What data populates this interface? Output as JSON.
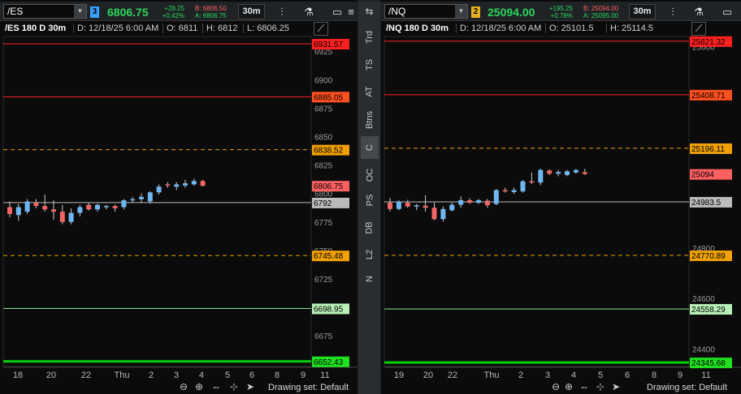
{
  "panels": [
    {
      "symbol": "/ES",
      "link_num": "3",
      "link_color": "#3aa0ff",
      "last": "6806.75",
      "change": "+28.25",
      "change_pct": "+0.42%",
      "bid": "B: 6806.50",
      "ask": "A: 6806.75",
      "timeframe": "30m",
      "info": {
        "title": "/ES 180 D 30m",
        "date": "D: 12/18/25 6:00 AM",
        "open": "O: 6811",
        "high": "H: 6812",
        "low": "L: 6806.25"
      },
      "y_range": [
        6648,
        6938
      ],
      "y_ticks": [
        "6925",
        "6900",
        "6875",
        "6850",
        "6825",
        "6800",
        "6775",
        "6750",
        "6725",
        "6700",
        "6675"
      ],
      "y_tick_values": [
        6925,
        6900,
        6875,
        6850,
        6825,
        6800,
        6775,
        6750,
        6725,
        6700,
        6675
      ],
      "x_ticks": [
        "18",
        "20",
        "22",
        "Thu",
        "2",
        "3",
        "4",
        "5",
        "6",
        "8",
        "9",
        "11"
      ],
      "levels": [
        {
          "value": 6931.57,
          "label": "6931.57",
          "color": "#ff2020",
          "bg": "#ff2020",
          "fg": "#000",
          "dash": false,
          "width": 1
        },
        {
          "value": 6885.05,
          "label": "6885.05",
          "color": "#ff2020",
          "bg": "#ff5020",
          "fg": "#000",
          "dash": false,
          "width": 1
        },
        {
          "value": 6838.52,
          "label": "6838.52",
          "color": "#f0a000",
          "bg": "#f0a000",
          "fg": "#000",
          "dash": true,
          "width": 1
        },
        {
          "value": 6792,
          "label": "6792",
          "color": "#bbbbbb",
          "bg": "#bbbbbb",
          "fg": "#000",
          "dash": false,
          "width": 1
        },
        {
          "value": 6745.48,
          "label": "6745.48",
          "color": "#f0a000",
          "bg": "#f0a000",
          "fg": "#000",
          "dash": true,
          "width": 1
        },
        {
          "value": 6698.95,
          "label": "6698.95",
          "color": "#88e888",
          "bg": "#b8f0b8",
          "fg": "#000",
          "dash": false,
          "width": 1
        },
        {
          "value": 6652.43,
          "label": "6652.43",
          "color": "#00d000",
          "bg": "#20e020",
          "fg": "#000",
          "dash": false,
          "width": 3
        }
      ],
      "last_label": {
        "value": 6806.75,
        "label": "6806.75",
        "bg": "#ff6060",
        "fg": "#000"
      },
      "candles": [
        {
          "o": 6788,
          "h": 6793,
          "l": 6779,
          "c": 6782
        },
        {
          "o": 6781,
          "h": 6791,
          "l": 6776,
          "c": 6788
        },
        {
          "o": 6784,
          "h": 6795,
          "l": 6782,
          "c": 6793
        },
        {
          "o": 6792,
          "h": 6795,
          "l": 6787,
          "c": 6789
        },
        {
          "o": 6789,
          "h": 6799,
          "l": 6784,
          "c": 6786
        },
        {
          "o": 6786,
          "h": 6794,
          "l": 6777,
          "c": 6784
        },
        {
          "o": 6784,
          "h": 6790,
          "l": 6773,
          "c": 6775
        },
        {
          "o": 6775,
          "h": 6787,
          "l": 6773,
          "c": 6783
        },
        {
          "o": 6783,
          "h": 6790,
          "l": 6780,
          "c": 6788
        },
        {
          "o": 6790,
          "h": 6792,
          "l": 6785,
          "c": 6786
        },
        {
          "o": 6786,
          "h": 6791,
          "l": 6784,
          "c": 6790
        },
        {
          "o": 6788,
          "h": 6790,
          "l": 6786,
          "c": 6789
        },
        {
          "o": 6789,
          "h": 6790,
          "l": 6784,
          "c": 6787
        },
        {
          "o": 6788,
          "h": 6795,
          "l": 6786,
          "c": 6794
        },
        {
          "o": 6794,
          "h": 6797,
          "l": 6792,
          "c": 6795
        },
        {
          "o": 6795,
          "h": 6800,
          "l": 6792,
          "c": 6797
        },
        {
          "o": 6793,
          "h": 6802,
          "l": 6791,
          "c": 6801
        },
        {
          "o": 6801,
          "h": 6808,
          "l": 6799,
          "c": 6806
        },
        {
          "o": 6808,
          "h": 6810,
          "l": 6805,
          "c": 6807
        },
        {
          "o": 6806,
          "h": 6810,
          "l": 6803,
          "c": 6808
        },
        {
          "o": 6807,
          "h": 6812,
          "l": 6805,
          "c": 6809
        },
        {
          "o": 6808,
          "h": 6813,
          "l": 6807,
          "c": 6811
        },
        {
          "o": 6811,
          "h": 6812,
          "l": 6806.25,
          "c": 6806.75
        }
      ],
      "drawing_set": "Drawing set: Default"
    },
    {
      "symbol": "/NQ",
      "link_num": "2",
      "link_color": "#e8b020",
      "last": "25094.00",
      "change": "+195.25",
      "change_pct": "+0.78%",
      "bid": "B: 25094.00",
      "ask": "A: 25095.00",
      "timeframe": "30m",
      "info": {
        "title": "/NQ 180 D 30m",
        "date": "D: 12/18/25 6:00 AM",
        "open": "O: 25101.5",
        "high": "H: 25114.5",
        "low": ""
      },
      "y_range": [
        24330,
        25640
      ],
      "y_ticks": [
        "25600",
        "24800",
        "24600",
        "24400"
      ],
      "y_tick_values": [
        25600,
        24800,
        24600,
        24400
      ],
      "x_ticks": [
        "19",
        "20",
        "22",
        "Thu",
        "2",
        "3",
        "4",
        "5",
        "6",
        "8",
        "9",
        "11"
      ],
      "levels": [
        {
          "value": 25621.32,
          "label": "25621.32",
          "color": "#ff2020",
          "bg": "#ff2020",
          "fg": "#000",
          "dash": false,
          "width": 1
        },
        {
          "value": 25408.71,
          "label": "25408.71",
          "color": "#ff2020",
          "bg": "#ff5020",
          "fg": "#000",
          "dash": false,
          "width": 1
        },
        {
          "value": 25196.11,
          "label": "25196.11",
          "color": "#f0a000",
          "bg": "#f0a000",
          "fg": "#000",
          "dash": true,
          "width": 1
        },
        {
          "value": 24983.5,
          "label": "24983.5",
          "color": "#bbbbbb",
          "bg": "#bbbbbb",
          "fg": "#000",
          "dash": false,
          "width": 1
        },
        {
          "value": 24770.89,
          "label": "24770.89",
          "color": "#f0a000",
          "bg": "#f0a000",
          "fg": "#000",
          "dash": true,
          "width": 1
        },
        {
          "value": 24558.29,
          "label": "24558.29",
          "color": "#88e888",
          "bg": "#b8f0b8",
          "fg": "#000",
          "dash": false,
          "width": 1
        },
        {
          "value": 24345.68,
          "label": "24345.68",
          "color": "#00d000",
          "bg": "#20e020",
          "fg": "#000",
          "dash": false,
          "width": 3
        }
      ],
      "last_label": {
        "value": 25094,
        "label": "25094",
        "bg": "#ff6060",
        "fg": "#000"
      },
      "candles": [
        {
          "o": 24980,
          "h": 25000,
          "l": 24945,
          "c": 24955
        },
        {
          "o": 24955,
          "h": 24990,
          "l": 24950,
          "c": 24985
        },
        {
          "o": 24980,
          "h": 24992,
          "l": 24960,
          "c": 24965
        },
        {
          "o": 24965,
          "h": 24975,
          "l": 24950,
          "c": 24970
        },
        {
          "o": 24968,
          "h": 25010,
          "l": 24945,
          "c": 24960
        },
        {
          "o": 24960,
          "h": 24980,
          "l": 24910,
          "c": 24915
        },
        {
          "o": 24915,
          "h": 24965,
          "l": 24905,
          "c": 24955
        },
        {
          "o": 24950,
          "h": 24980,
          "l": 24945,
          "c": 24972
        },
        {
          "o": 24972,
          "h": 25005,
          "l": 24960,
          "c": 24990
        },
        {
          "o": 24990,
          "h": 24998,
          "l": 24975,
          "c": 24980
        },
        {
          "o": 24980,
          "h": 24995,
          "l": 24975,
          "c": 24990
        },
        {
          "o": 24988,
          "h": 24995,
          "l": 24960,
          "c": 24970
        },
        {
          "o": 24975,
          "h": 25035,
          "l": 24970,
          "c": 25030
        },
        {
          "o": 25030,
          "h": 25040,
          "l": 25020,
          "c": 25025
        },
        {
          "o": 25022,
          "h": 25040,
          "l": 25015,
          "c": 25030
        },
        {
          "o": 25025,
          "h": 25070,
          "l": 25020,
          "c": 25065
        },
        {
          "o": 25065,
          "h": 25100,
          "l": 25055,
          "c": 25060
        },
        {
          "o": 25060,
          "h": 25115,
          "l": 25050,
          "c": 25110
        },
        {
          "o": 25108,
          "h": 25112,
          "l": 25090,
          "c": 25095
        },
        {
          "o": 25095,
          "h": 25110,
          "l": 25085,
          "c": 25102
        },
        {
          "o": 25090,
          "h": 25110,
          "l": 25085,
          "c": 25105
        },
        {
          "o": 25100,
          "h": 25114,
          "l": 25095,
          "c": 25110
        },
        {
          "o": 25101.5,
          "h": 25114.5,
          "l": 25090,
          "c": 25094
        }
      ],
      "drawing_set": "Drawing set: Default"
    }
  ],
  "sidebar": {
    "items": [
      "Trd",
      "TS",
      "AT",
      "Btns",
      "C",
      "OC",
      "PS",
      "DB",
      "L2",
      "N"
    ],
    "active": "C"
  },
  "colors": {
    "up": "#6fb7f2",
    "down": "#f26666",
    "wick": "#cccccc"
  }
}
